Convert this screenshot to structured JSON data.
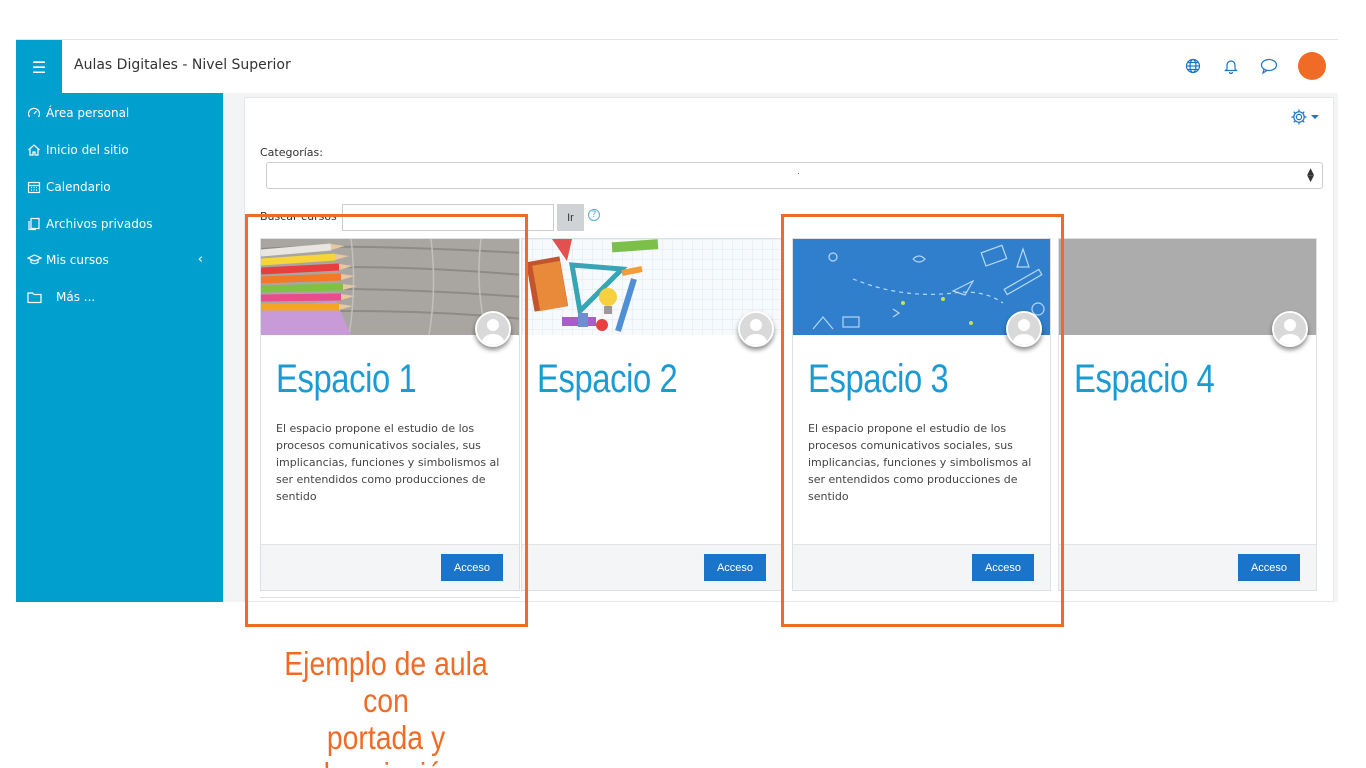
{
  "app": {
    "title": "Aulas Digitales - Nivel Superior"
  },
  "navbar": {
    "icons": [
      "menu-icon",
      "globe-icon",
      "bell-icon",
      "chat-icon",
      "user-avatar"
    ]
  },
  "colors": {
    "sidebar": "#009fcd",
    "accent": "#1a74c9",
    "title_blue": "#1b9bd4",
    "annotation": "#f06b25"
  },
  "sidebar": {
    "items": [
      {
        "label": "Área personal",
        "icon": "dashboard-icon"
      },
      {
        "label": "Inicio del sitio",
        "icon": "home-icon"
      },
      {
        "label": "Calendario",
        "icon": "calendar-icon"
      },
      {
        "label": "Archivos privados",
        "icon": "files-icon"
      },
      {
        "label": "Mis cursos",
        "icon": "graduation-cap-icon"
      },
      {
        "label": "Más ...",
        "icon": "folder-icon"
      }
    ]
  },
  "filters": {
    "categories_label": "Categorías:",
    "categories_value": ".",
    "search_label": "Buscar cursos",
    "search_value": "",
    "search_button": "Ir"
  },
  "courses": [
    {
      "title": "Espacio 1",
      "description": "El espacio propone el estudio de los procesos comunicativos sociales, sus implicancias, funciones y simbolismos al ser entendidos como producciones de sentido",
      "button": "Acceso",
      "cover": "colored-pencils-on-wood"
    },
    {
      "title": "Espacio 2",
      "description": "",
      "button": "Acceso",
      "cover": "school-supplies-on-grid"
    },
    {
      "title": "Espacio 3",
      "description": "El espacio propone el estudio de los procesos comunicativos sociales, sus implicancias, funciones y simbolismos al ser entendidos como producciones de sentido",
      "button": "Acceso",
      "cover": "blue-doodle-pattern"
    },
    {
      "title": "Espacio 4",
      "description": "",
      "button": "Acceso",
      "cover": "plain-gray"
    }
  ],
  "annotation": {
    "line1": "Ejemplo de aula con",
    "line2": "portada y descripción"
  }
}
